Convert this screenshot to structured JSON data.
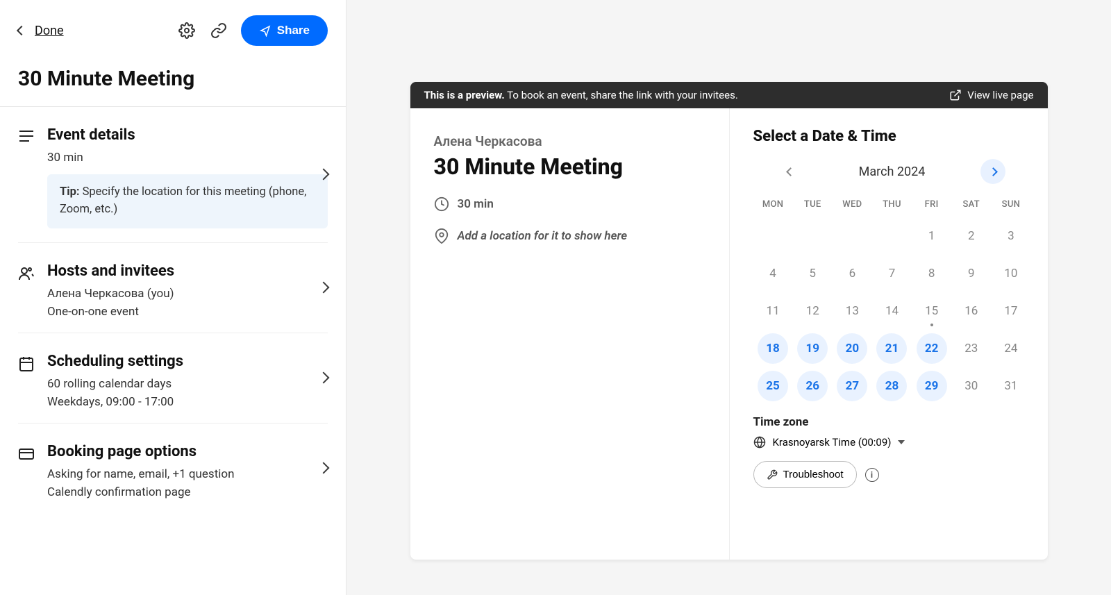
{
  "header": {
    "done": "Done",
    "share": "Share",
    "title": "30 Minute Meeting"
  },
  "sections": {
    "eventDetails": {
      "title": "Event details",
      "duration": "30 min",
      "tipBold": "Tip:",
      "tipText": " Specify the location for this meeting (phone, Zoom, etc.)"
    },
    "hosts": {
      "title": "Hosts and invitees",
      "line1": "Алена Черкасова (you)",
      "line2": "One-on-one event"
    },
    "scheduling": {
      "title": "Scheduling settings",
      "line1": "60 rolling calendar days",
      "line2": "Weekdays, 09:00 - 17:00"
    },
    "booking": {
      "title": "Booking page options",
      "line1": "Asking for name, email, +1 question",
      "line2": "Calendly confirmation page"
    }
  },
  "preview": {
    "bannerBold": "This is a preview.",
    "bannerRest": " To book an event, share the link with your invitees.",
    "viewLive": "View live page",
    "hostName": "Алена Черкасова",
    "meetingTitle": "30 Minute Meeting",
    "duration": "30 min",
    "locationPlaceholder": "Add a location for it to show here",
    "selectHeading": "Select a Date & Time",
    "monthLabel": "March 2024",
    "dow": [
      "MON",
      "TUE",
      "WED",
      "THU",
      "FRI",
      "SAT",
      "SUN"
    ],
    "days": [
      {
        "n": "",
        "avail": false
      },
      {
        "n": "",
        "avail": false
      },
      {
        "n": "",
        "avail": false
      },
      {
        "n": "",
        "avail": false
      },
      {
        "n": "1",
        "avail": false
      },
      {
        "n": "2",
        "avail": false
      },
      {
        "n": "3",
        "avail": false
      },
      {
        "n": "4",
        "avail": false
      },
      {
        "n": "5",
        "avail": false
      },
      {
        "n": "6",
        "avail": false
      },
      {
        "n": "7",
        "avail": false
      },
      {
        "n": "8",
        "avail": false
      },
      {
        "n": "9",
        "avail": false
      },
      {
        "n": "10",
        "avail": false
      },
      {
        "n": "11",
        "avail": false
      },
      {
        "n": "12",
        "avail": false
      },
      {
        "n": "13",
        "avail": false
      },
      {
        "n": "14",
        "avail": false
      },
      {
        "n": "15",
        "avail": false,
        "dot": true
      },
      {
        "n": "16",
        "avail": false
      },
      {
        "n": "17",
        "avail": false
      },
      {
        "n": "18",
        "avail": true
      },
      {
        "n": "19",
        "avail": true
      },
      {
        "n": "20",
        "avail": true
      },
      {
        "n": "21",
        "avail": true
      },
      {
        "n": "22",
        "avail": true
      },
      {
        "n": "23",
        "avail": false
      },
      {
        "n": "24",
        "avail": false
      },
      {
        "n": "25",
        "avail": true
      },
      {
        "n": "26",
        "avail": true
      },
      {
        "n": "27",
        "avail": true
      },
      {
        "n": "28",
        "avail": true
      },
      {
        "n": "29",
        "avail": true
      },
      {
        "n": "30",
        "avail": false
      },
      {
        "n": "31",
        "avail": false
      }
    ],
    "tzLabel": "Time zone",
    "tzValue": "Krasnoyarsk Time (00:09)",
    "troubleshoot": "Troubleshoot"
  }
}
